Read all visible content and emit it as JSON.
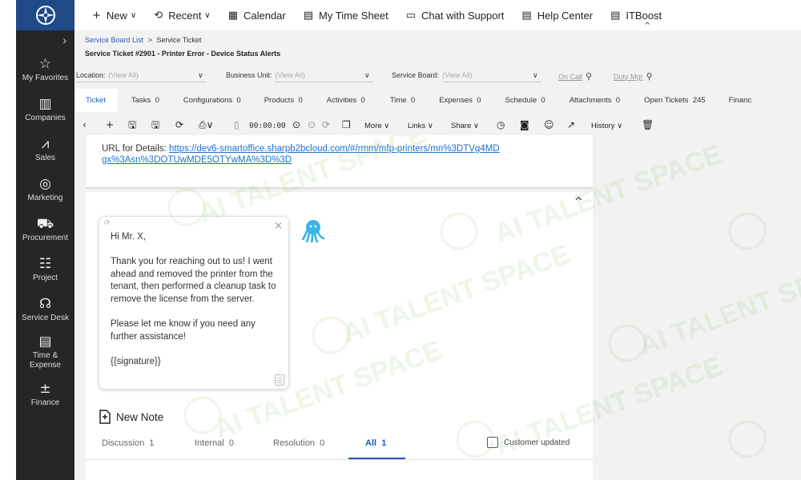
{
  "sidebar": {
    "items": [
      {
        "icon": "star-icon",
        "glyph": "☆",
        "label": "My Favorites"
      },
      {
        "icon": "building-icon",
        "glyph": "▦",
        "label": "Companies"
      },
      {
        "icon": "chart-icon",
        "glyph": "📈",
        "label": "Sales"
      },
      {
        "icon": "target-icon",
        "glyph": "◎",
        "label": "Marketing"
      },
      {
        "icon": "cart-icon",
        "glyph": "🛒",
        "label": "Procurement"
      },
      {
        "icon": "project-icon",
        "glyph": "☷",
        "label": "Project"
      },
      {
        "icon": "headset-icon",
        "glyph": "🎧",
        "label": "Service Desk"
      },
      {
        "icon": "timesheet-icon",
        "glyph": "▤",
        "label": "Time &\nExpense"
      },
      {
        "icon": "calculator-icon",
        "glyph": "±",
        "label": "Finance"
      }
    ]
  },
  "topbar": {
    "new": "New",
    "recent": "Recent",
    "calendar": "Calendar",
    "my_time_sheet": "My Time Sheet",
    "chat": "Chat with Support",
    "help": "Help Center",
    "itboost": "ITBoost"
  },
  "breadcrumb": {
    "parent": "Service Board List",
    "sep": ">",
    "current": "Service Ticket"
  },
  "ticket_title": "Service Ticket #2901 - Printer Error - Device Status Alerts",
  "filters": {
    "location_label": "Location:",
    "location_value": "(View All)",
    "business_unit_label": "Business Unit:",
    "business_unit_value": "(View All)",
    "service_board_label": "Service Board:",
    "service_board_value": "(View All)",
    "on_call": "On Call",
    "duty_mgr": "Duty Mgr"
  },
  "tabs": [
    {
      "label": "Ticket",
      "count": ""
    },
    {
      "label": "Tasks",
      "count": "0"
    },
    {
      "label": "Configurations",
      "count": "0"
    },
    {
      "label": "Products",
      "count": "0"
    },
    {
      "label": "Activities",
      "count": "0"
    },
    {
      "label": "Time",
      "count": "0"
    },
    {
      "label": "Expenses",
      "count": "0"
    },
    {
      "label": "Schedule",
      "count": "0"
    },
    {
      "label": "Attachments",
      "count": "0"
    },
    {
      "label": "Open Tickets",
      "count": "245"
    },
    {
      "label": "Financ",
      "count": ""
    }
  ],
  "toolbar": {
    "timer": "00:00:00",
    "more": "More",
    "links": "Links",
    "share": "Share",
    "history": "History"
  },
  "detail": {
    "url_label": "URL for Details:",
    "url": "https://dev6-smartoffice.sharpb2bcloud.com/#/rmm/mfp-printers/mn%3DTVg4MDgx%3Asn%3DOTUwMDE5OTYwMA%3D%3D"
  },
  "note": {
    "text": "Hi Mr. X,\n\nThank you for reaching out to us! I went ahead and removed the printer from the tenant, then performed a cleanup task to remove the license from the server.\n\nPlease let me know if you need any further assistance!\n\n{{signature}}"
  },
  "new_note": "New Note",
  "note_tabs": [
    {
      "label": "Discussion",
      "count": "1"
    },
    {
      "label": "Internal",
      "count": "0"
    },
    {
      "label": "Resolution",
      "count": "0"
    },
    {
      "label": "All",
      "count": "1"
    }
  ],
  "customer_updated": "Customer updated",
  "watermark": "AI TALENT SPACE",
  "colors": {
    "sidebar": "#262626",
    "logo_bg": "#1f4a87",
    "accent": "#1c5bb8",
    "link": "#1e6fcf",
    "header_bg": "#f2f2f2"
  }
}
